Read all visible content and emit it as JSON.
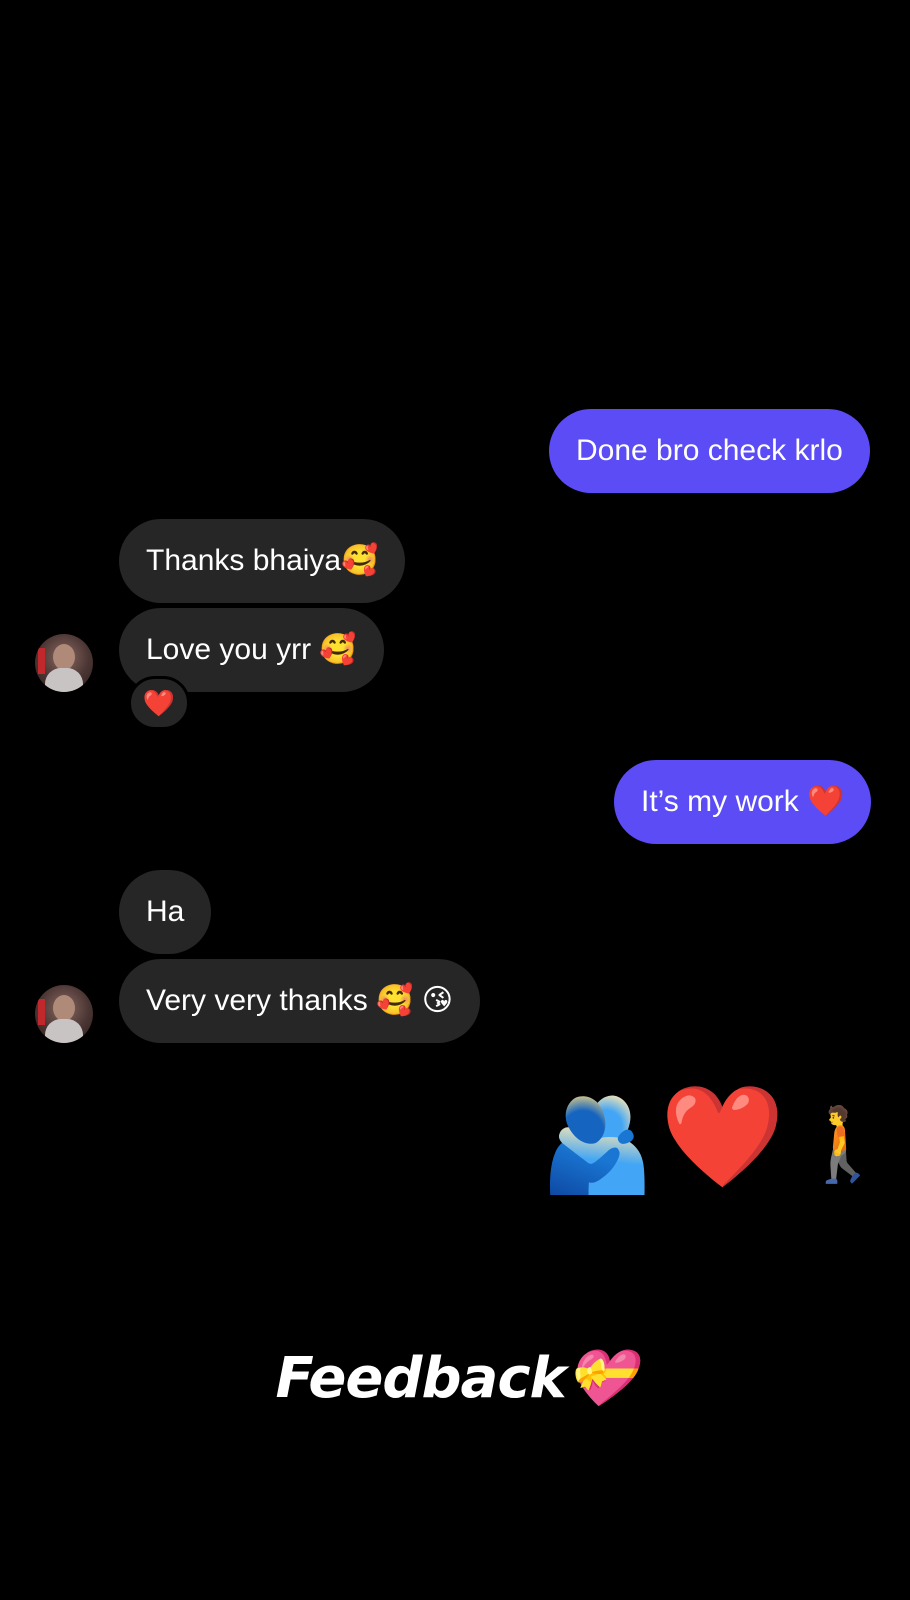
{
  "messages": [
    {
      "id": "m1",
      "side": "out",
      "text": "Done bro check krlo"
    },
    {
      "id": "m2",
      "side": "in",
      "text": "Thanks bhaiya🥰"
    },
    {
      "id": "m3",
      "side": "in",
      "text": "Love you yrr 🥰",
      "reaction": "❤️"
    },
    {
      "id": "m4",
      "side": "out",
      "text": "It’s my work ❤️"
    },
    {
      "id": "m5",
      "side": "in",
      "text": "Ha"
    },
    {
      "id": "m6",
      "side": "in",
      "text": "Very very thanks 🥰 😘"
    }
  ],
  "emoji_message": {
    "hug": "🫂",
    "heart": "❤️",
    "walk": "🚶"
  },
  "caption": "Feedback💝",
  "colors": {
    "background": "#000000",
    "outgoing_bubble": "#5b4cf6",
    "incoming_bubble": "#262626",
    "text": "#ffffff"
  },
  "icons": [
    "contact-avatar",
    "heart-reaction-icon"
  ]
}
